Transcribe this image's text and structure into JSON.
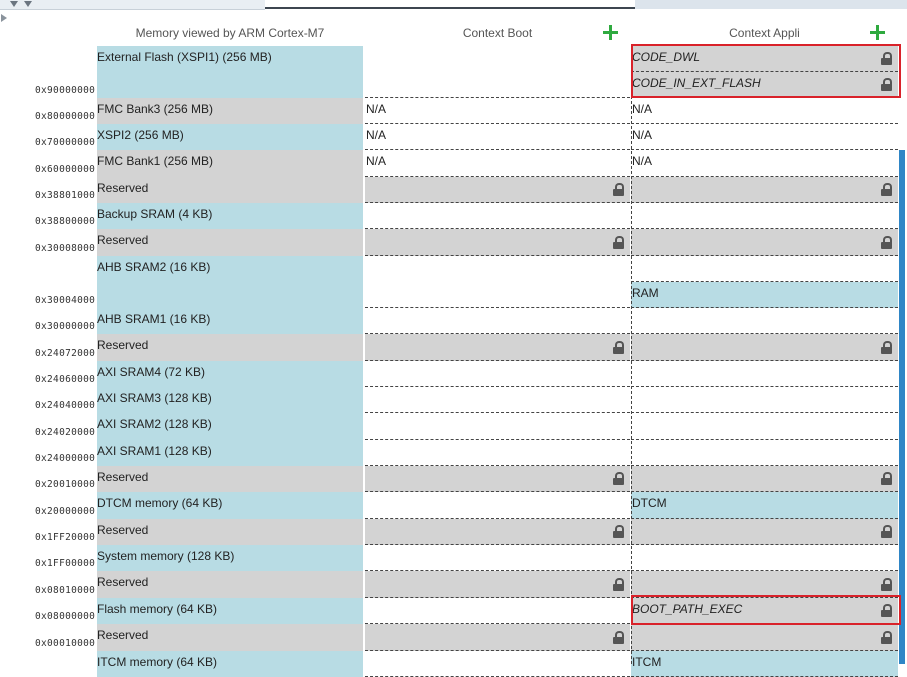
{
  "headers": {
    "memory_view": "Memory viewed by ARM Cortex-M7",
    "context_boot": "Context Boot",
    "context_appli": "Context Appli"
  },
  "icons": {
    "add": "plus-icon",
    "lock": "lock-icon"
  },
  "colors": {
    "memory_region": "#b8dce4",
    "reserved_region": "#d3d3d3",
    "add_button": "#2faa3f",
    "highlight": "#d9222a",
    "scrollbar": "#2f86c6"
  },
  "rows": [
    {
      "address": "0x90000000",
      "label": "External Flash (XSPI1) (256 MB)",
      "kind": "mem",
      "boot": "",
      "appli_sub": [
        {
          "text": "CODE_DWL",
          "italic": true,
          "locked": true
        },
        {
          "text": "CODE_IN_EXT_FLASH",
          "italic": true,
          "locked": true
        }
      ]
    },
    {
      "address": "0x80000000",
      "label": "FMC Bank3 (256 MB)",
      "kind": "res",
      "boot": "N/A",
      "appli": "N/A"
    },
    {
      "address": "0x70000000",
      "label": "XSPI2 (256 MB)",
      "kind": "mem",
      "boot": "N/A",
      "appli": "N/A"
    },
    {
      "address": "0x60000000",
      "label": "FMC Bank1 (256 MB)",
      "kind": "res",
      "boot": "N/A",
      "appli": "N/A"
    },
    {
      "address": "0x38801000",
      "label": "Reserved",
      "kind": "res",
      "boot_locked": true,
      "appli_locked": true
    },
    {
      "address": "0x38800000",
      "label": "Backup SRAM (4 KB)",
      "kind": "mem"
    },
    {
      "address": "0x30008000",
      "label": "Reserved",
      "kind": "res",
      "boot_locked": true,
      "appli_locked": true
    },
    {
      "address": "0x30004000",
      "label": "AHB SRAM2 (16 KB)",
      "kind": "mem",
      "appli": "RAM",
      "appli_blue": true
    },
    {
      "address": "0x30000000",
      "label": "AHB SRAM1 (16 KB)",
      "kind": "mem"
    },
    {
      "address": "0x24072000",
      "label": "Reserved",
      "kind": "res",
      "boot_locked": true,
      "appli_locked": true
    },
    {
      "address": "0x24060000",
      "label": "AXI SRAM4 (72 KB)",
      "kind": "mem"
    },
    {
      "address": "0x24040000",
      "label": "AXI SRAM3 (128 KB)",
      "kind": "mem"
    },
    {
      "address": "0x24020000",
      "label": "AXI SRAM2 (128 KB)",
      "kind": "mem"
    },
    {
      "address": "0x24000000",
      "label": "AXI SRAM1 (128 KB)",
      "kind": "mem"
    },
    {
      "address": "0x20010000",
      "label": "Reserved",
      "kind": "res",
      "boot_locked": true,
      "appli_locked": true
    },
    {
      "address": "0x20000000",
      "label": "DTCM memory (64 KB)",
      "kind": "mem",
      "appli": "DTCM",
      "appli_blue": true
    },
    {
      "address": "0x1FF20000",
      "label": "Reserved",
      "kind": "res",
      "boot_locked": true,
      "appli_locked": true
    },
    {
      "address": "0x1FF00000",
      "label": "System memory (128 KB)",
      "kind": "mem"
    },
    {
      "address": "0x08010000",
      "label": "Reserved",
      "kind": "res",
      "boot_locked": true,
      "appli_locked": true
    },
    {
      "address": "0x08000000",
      "label": "Flash memory (64 KB)",
      "kind": "mem",
      "appli": "BOOT_PATH_EXEC",
      "appli_italic": true,
      "appli_locked": true,
      "appli_gray": true
    },
    {
      "address": "0x00010000",
      "label": "Reserved",
      "kind": "res",
      "boot_locked": true,
      "appli_locked": true
    },
    {
      "address": "",
      "label": "ITCM memory (64 KB)",
      "kind": "mem",
      "appli": "ITCM",
      "appli_blue": true
    }
  ]
}
